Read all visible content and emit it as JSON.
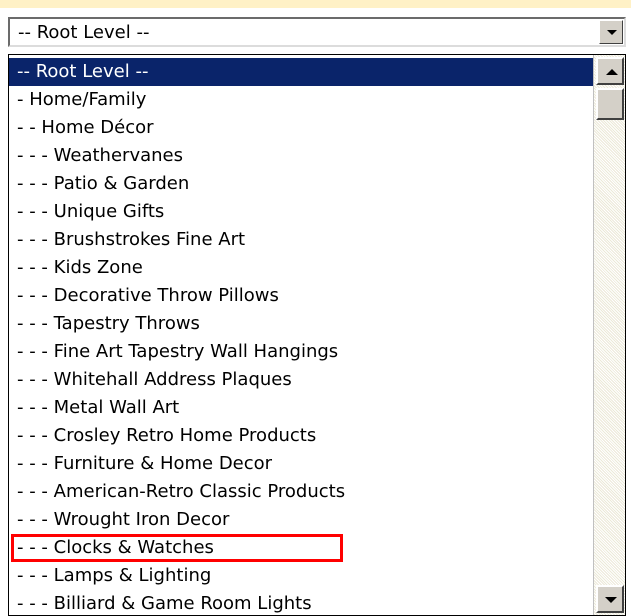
{
  "combo": {
    "selected_value": "-- Root Level --"
  },
  "list": {
    "items": [
      {
        "label": "-- Root Level --",
        "selected": true
      },
      {
        "label": "- Home/Family"
      },
      {
        "label": "- - Home Décor"
      },
      {
        "label": "- - - Weathervanes"
      },
      {
        "label": "- - - Patio & Garden"
      },
      {
        "label": "- - - Unique Gifts"
      },
      {
        "label": "- - - Brushstrokes Fine Art"
      },
      {
        "label": "- - - Kids Zone"
      },
      {
        "label": "- - - Decorative Throw Pillows"
      },
      {
        "label": "- - - Tapestry Throws"
      },
      {
        "label": "- - - Fine Art Tapestry Wall Hangings"
      },
      {
        "label": "- - - Whitehall Address Plaques"
      },
      {
        "label": "- - - Metal Wall Art"
      },
      {
        "label": "- - - Crosley Retro Home Products"
      },
      {
        "label": "- - - Furniture & Home Decor"
      },
      {
        "label": "- - - American-Retro Classic Products"
      },
      {
        "label": "- - - Wrought Iron Decor"
      },
      {
        "label": "- - - Clocks & Watches",
        "highlighted": true
      },
      {
        "label": "- - - Lamps & Lighting"
      },
      {
        "label": "- - - Billiard & Game Room Lights"
      }
    ]
  },
  "colors": {
    "selection": "#0a246a",
    "highlight_box": "#ff0000",
    "top_strip": "#fff1c6"
  },
  "icons": {
    "combo_arrow": "chevron-down-icon",
    "scroll_up": "arrow-up-icon",
    "scroll_down": "arrow-down-icon"
  }
}
